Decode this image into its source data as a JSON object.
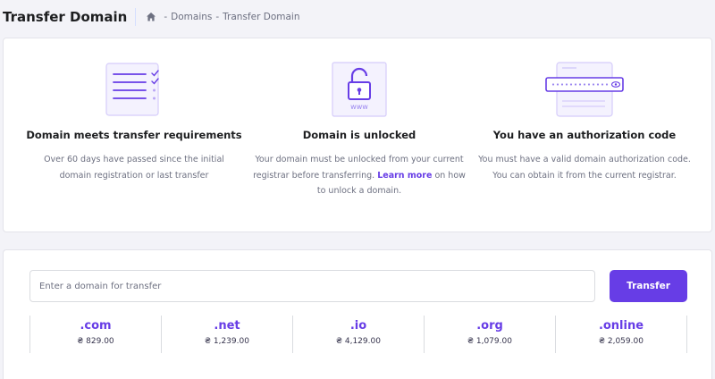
{
  "header": {
    "title": "Transfer Domain",
    "breadcrumb": {
      "separator": "-",
      "items": [
        "Domains",
        "Transfer Domain"
      ]
    }
  },
  "requirements": [
    {
      "icon": "checklist-icon",
      "title": "Domain meets transfer requirements",
      "description": "Over 60 days have passed since the initial domain registration or last transfer"
    },
    {
      "icon": "unlocked-padlock-icon",
      "title": "Domain is unlocked",
      "description_before": "Your domain must be unlocked from your current registrar before transferring.",
      "link_text": "Learn more",
      "description_after": "on how to unlock a domain.",
      "icon_label": "www"
    },
    {
      "icon": "password-field-icon",
      "title": "You have an authorization code",
      "description": "You must have a valid domain authorization code. You can obtain it from the current registrar."
    }
  ],
  "search": {
    "placeholder": "Enter a domain for transfer",
    "value": "",
    "button_label": "Transfer"
  },
  "tlds": [
    {
      "name": ".com",
      "price": "₴ 829.00"
    },
    {
      "name": ".net",
      "price": "₴ 1,239.00"
    },
    {
      "name": ".io",
      "price": "₴ 4,129.00"
    },
    {
      "name": ".org",
      "price": "₴ 1,079.00"
    },
    {
      "name": ".online",
      "price": "₴ 2,059.00"
    }
  ],
  "colors": {
    "accent": "#673de6",
    "text_dark": "#1d1e20",
    "text_muted": "#6d7081",
    "background": "#f3f3f8"
  }
}
